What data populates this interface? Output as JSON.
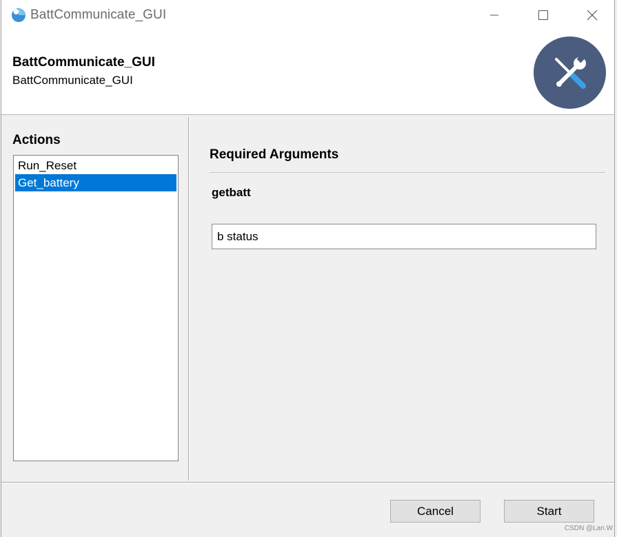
{
  "window": {
    "title": "BattCommunicate_GUI"
  },
  "header": {
    "title": "BattCommunicate_GUI",
    "subtitle": "BattCommunicate_GUI",
    "logo_icon": "tools-icon",
    "logo_color": "#4a5d7e"
  },
  "actions": {
    "label": "Actions",
    "items": [
      {
        "label": "Run_Reset",
        "selected": false
      },
      {
        "label": "Get_battery",
        "selected": true
      }
    ],
    "selection_color": "#0078d7"
  },
  "arguments": {
    "title": "Required Arguments",
    "arg_label": "getbatt",
    "arg_value": "b status"
  },
  "footer": {
    "cancel_label": "Cancel",
    "start_label": "Start"
  },
  "watermark": "CSDN @Lan.W"
}
